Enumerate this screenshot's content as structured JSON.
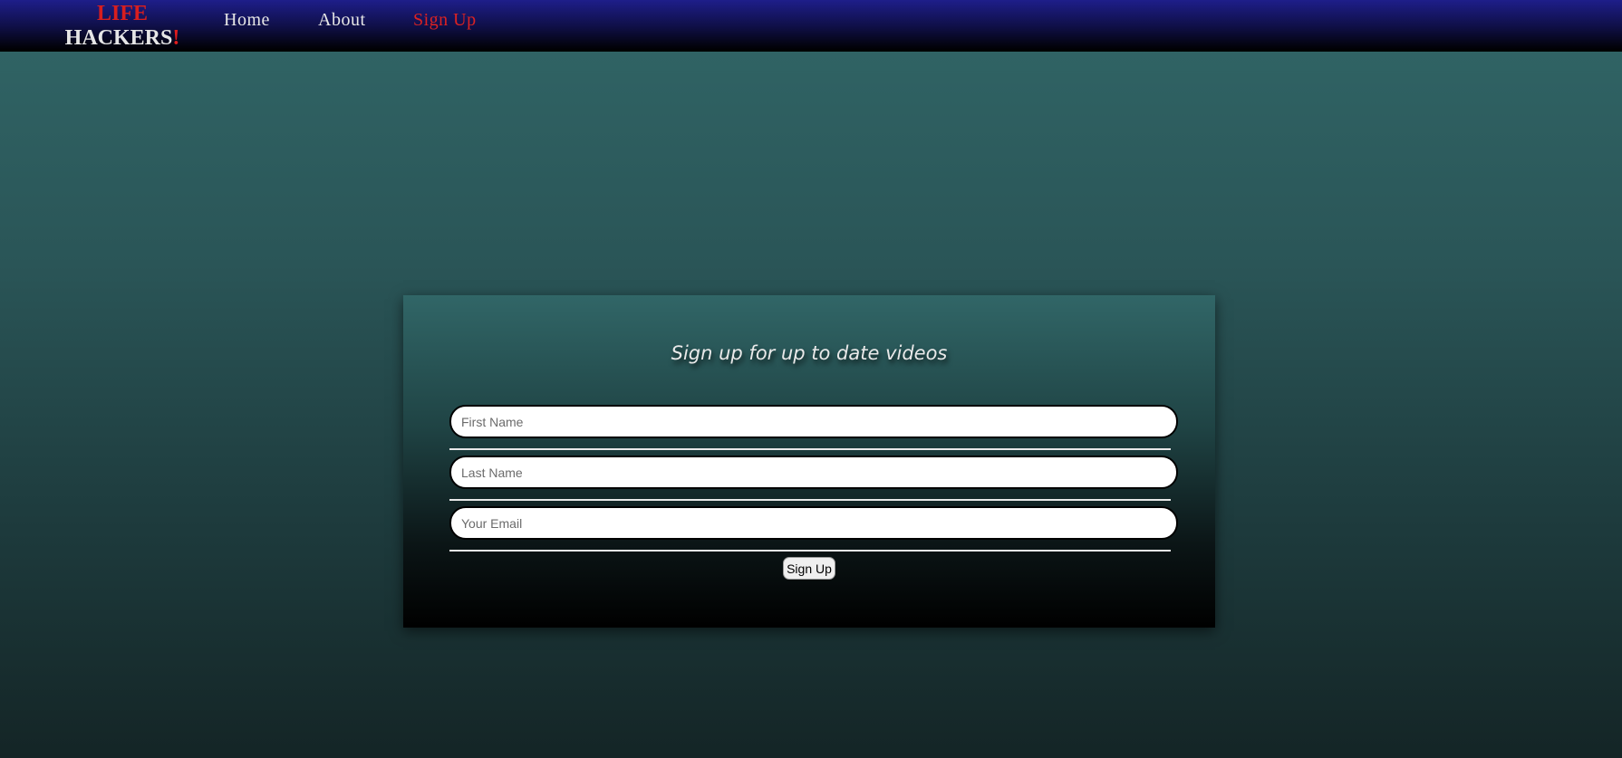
{
  "navbar": {
    "logo": {
      "line1": "LIFE",
      "line2": "HACKERS",
      "bang": "!"
    },
    "links": [
      {
        "label": "Home"
      },
      {
        "label": "About"
      },
      {
        "label": "Sign Up"
      }
    ]
  },
  "signup": {
    "title": "Sign up for up to date videos",
    "first_name": {
      "placeholder": "First Name",
      "value": ""
    },
    "last_name": {
      "placeholder": "Last Name",
      "value": ""
    },
    "email": {
      "placeholder": "Your Email",
      "value": ""
    },
    "submit_label": "Sign Up"
  },
  "colors": {
    "accent_red": "#dd2222",
    "nav_dark_blue": "#1e1e8a",
    "page_teal": "#316667"
  }
}
